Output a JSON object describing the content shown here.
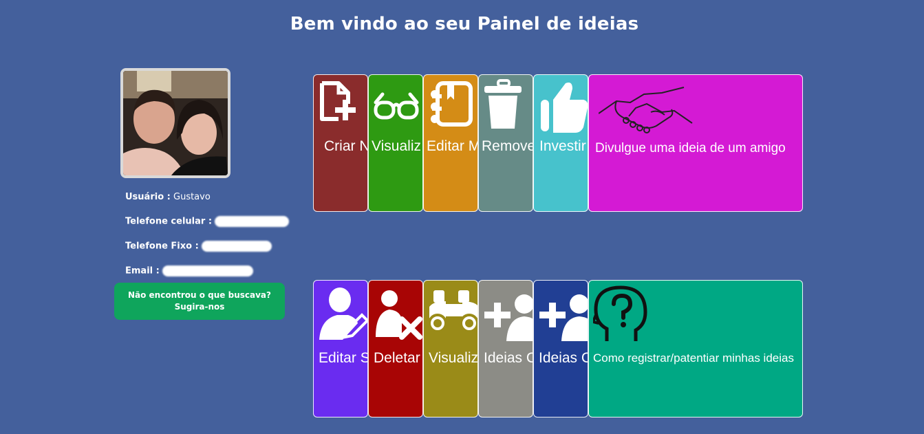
{
  "header": {
    "title": "Bem vindo ao seu Painel de ideias"
  },
  "profile": {
    "user_label": "Usuário :",
    "user_value": "Gustavo",
    "mobile_label": "Telefone celular :",
    "landline_label": "Telefone Fixo :",
    "email_label": "Email :",
    "suggest_line1": "Não encontrou o que buscava?",
    "suggest_line2": "Sugira-nos"
  },
  "tiles_row1": [
    {
      "label": "Criar N",
      "color": "#8a2c2c",
      "icon": "new-file-icon"
    },
    {
      "label": "Visualiz",
      "color": "#2e9a12",
      "icon": "glasses-icon"
    },
    {
      "label": "Editar M",
      "color": "#d48c16",
      "icon": "notebook-icon"
    },
    {
      "label": "Remove",
      "color": "#668b87",
      "icon": "trash-icon"
    },
    {
      "label": "Investir",
      "color": "#47c2cc",
      "icon": "thumbs-up-icon"
    },
    {
      "label": "Divulgue uma ideia de um amigo",
      "color": "#d41ad4",
      "icon": "handshake-icon"
    }
  ],
  "tiles_row2": [
    {
      "label": "Editar S",
      "color": "#6a2cf0",
      "icon": "edit-user-icon"
    },
    {
      "label": "Deletar",
      "color": "#a80505",
      "icon": "delete-user-icon"
    },
    {
      "label": "Visualiz",
      "color": "#9a8b18",
      "icon": "binoculars-icon"
    },
    {
      "label": "Ideias C",
      "color": "#8c8c86",
      "icon": "add-users-icon"
    },
    {
      "label": "Ideias C",
      "color": "#213f94",
      "icon": "add-users-icon"
    },
    {
      "label": "Como registrar/patentiar minhas ideias",
      "color": "#00a884",
      "icon": "head-question-icon"
    }
  ]
}
